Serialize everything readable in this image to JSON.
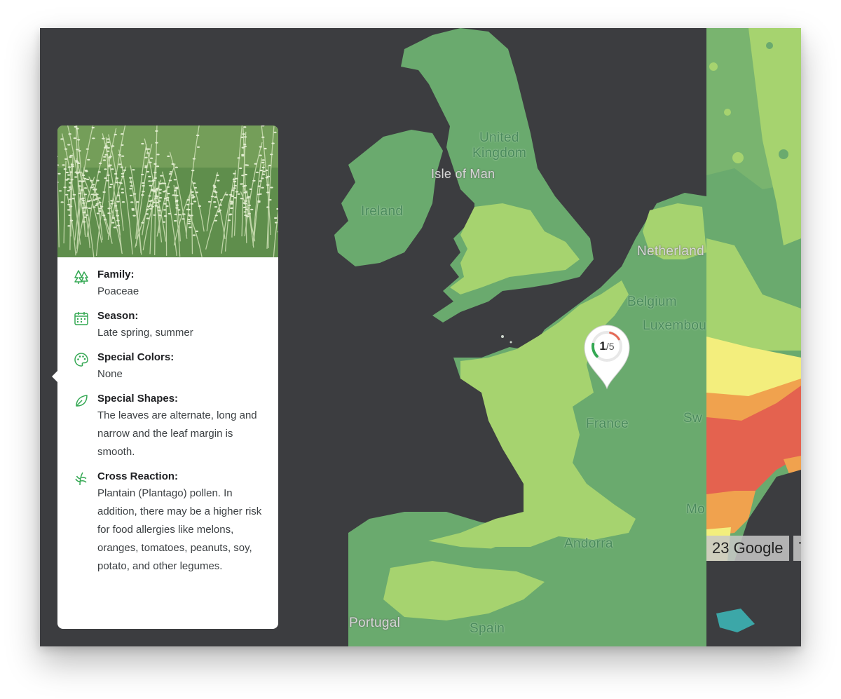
{
  "map": {
    "labels": {
      "united_kingdom_1": "United",
      "united_kingdom_2": "Kingdom",
      "isle_of_man": "Isle of Man",
      "ireland": "Ireland",
      "netherlands": "Netherland",
      "belgium": "Belgium",
      "luxembourg": "Luxembou",
      "france": "France",
      "switzerland": "Sw",
      "monaco": "Mo",
      "andorra": "Andorra",
      "portugal": "Portugal",
      "spain": "Spain"
    },
    "attribution": {
      "copyright": "23 Google",
      "terms": "T"
    },
    "colors": {
      "water": "#3c3d40",
      "low_green": "#6aaa6e",
      "light_green": "#a6d36f",
      "yellow": "#f3ee7d",
      "orange": "#f0a24e",
      "red": "#e4624f"
    }
  },
  "marker": {
    "numerator": "1",
    "denominator": "/5",
    "fraction": 0.2
  },
  "card": {
    "photo_icon": "grass-photo",
    "rows": [
      {
        "icon": "tree-icon",
        "label": "Family:",
        "value": "Poaceae"
      },
      {
        "icon": "calendar-icon",
        "label": "Season:",
        "value": "Late spring, summer"
      },
      {
        "icon": "palette-icon",
        "label": "Special Colors:",
        "value": "None"
      },
      {
        "icon": "leaf-icon",
        "label": "Special Shapes:",
        "value": "The leaves are alternate, long and narrow and the leaf margin is smooth."
      },
      {
        "icon": "grass-icon",
        "label": "Cross Reaction:",
        "value": "Plantain (Plantago) pollen. In addition, there may be a higher risk for food allergies like melons, oranges, tomatoes, peanuts, soy, potato, and other legumes."
      }
    ]
  }
}
